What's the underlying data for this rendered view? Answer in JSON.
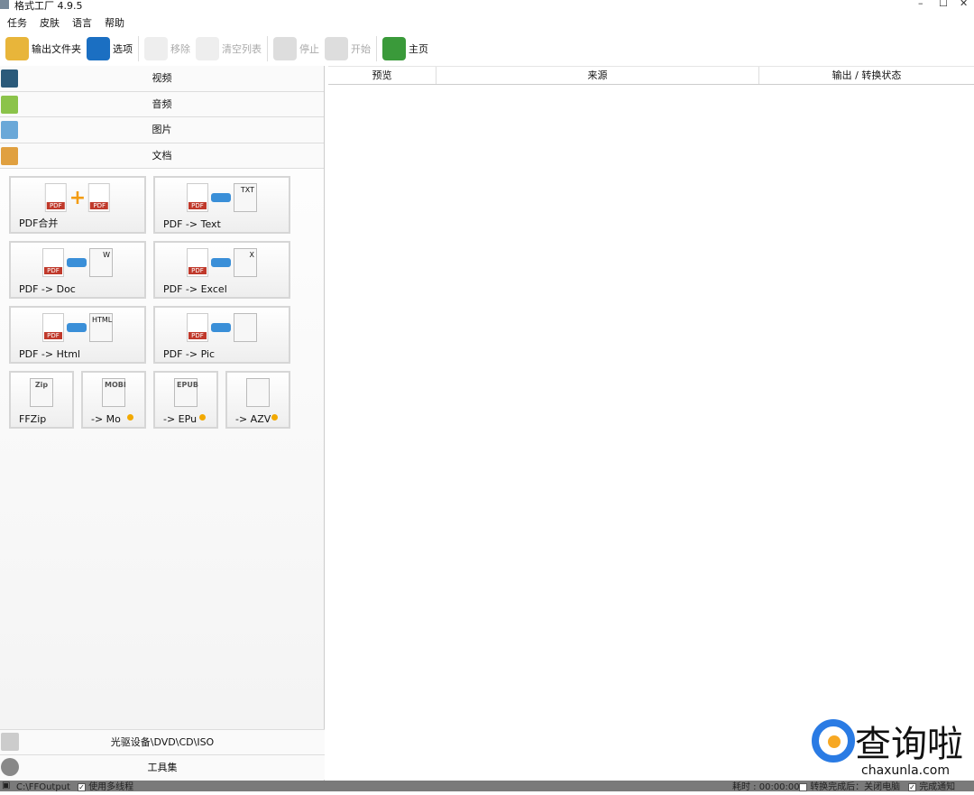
{
  "window": {
    "title": "格式工厂 4.9.5",
    "minimize": "–",
    "maximize": "☐",
    "close": "✕"
  },
  "menu": [
    "任务",
    "皮肤",
    "语言",
    "帮助"
  ],
  "toolbar": [
    {
      "label": "输出文件夹",
      "icon": "folder-icon",
      "enabled": true,
      "color": "#e8b53a"
    },
    {
      "label": "选项",
      "icon": "gear-icon",
      "enabled": true,
      "color": "#1b6fc2"
    },
    {
      "label": "移除",
      "icon": "remove-icon",
      "enabled": false,
      "color": "#eee"
    },
    {
      "label": "清空列表",
      "icon": "clear-list-icon",
      "enabled": false,
      "color": "#eee"
    },
    {
      "label": "停止",
      "icon": "stop-icon",
      "enabled": false,
      "color": "#ddd"
    },
    {
      "label": "开始",
      "icon": "start-icon",
      "enabled": false,
      "color": "#ddd"
    },
    {
      "label": "主页",
      "icon": "globe-icon",
      "enabled": true,
      "color": "#3a9a3a"
    }
  ],
  "categories": [
    {
      "label": "视频",
      "icon": "film-icon",
      "color": "#2b5a7a"
    },
    {
      "label": "音频",
      "icon": "music-note-icon",
      "color": "#8bc34a"
    },
    {
      "label": "图片",
      "icon": "picture-icon",
      "color": "#6aa8d8"
    },
    {
      "label": "文档",
      "icon": "document-icon",
      "color": "#e0a040"
    }
  ],
  "tools": [
    {
      "label": "PDF合并",
      "extra": "+"
    },
    {
      "label": "PDF -> Text",
      "extra": "TXT"
    },
    {
      "label": "PDF -> Doc",
      "extra": "W"
    },
    {
      "label": "PDF -> Excel",
      "extra": "X"
    },
    {
      "label": "PDF -> Html",
      "extra": "HTML"
    },
    {
      "label": "PDF -> Pic",
      "extra": ""
    },
    {
      "label": "FFZip",
      "extra": "Zip"
    },
    {
      "label": "-> Mo",
      "extra": "MOBI"
    },
    {
      "label": "-> EPu",
      "extra": "EPUB"
    },
    {
      "label": "-> AZV",
      "extra": ""
    }
  ],
  "bottom_categories": [
    {
      "label": "光驱设备\\DVD\\CD\\ISO",
      "icon": "disc-drive-icon"
    },
    {
      "label": "工具集",
      "icon": "toolbox-icon"
    }
  ],
  "table": {
    "columns": [
      "预览",
      "来源",
      "输出 / 转换状态"
    ]
  },
  "status": {
    "output_path": "C:\\FFOutput",
    "multithread": "使用多线程",
    "elapsed": "耗时 : 00:00:00",
    "shutdown": "转换完成后：关闭电脑",
    "notify": "完成通知"
  },
  "watermark": {
    "text": "查询啦",
    "url": "chaxunla.com"
  }
}
